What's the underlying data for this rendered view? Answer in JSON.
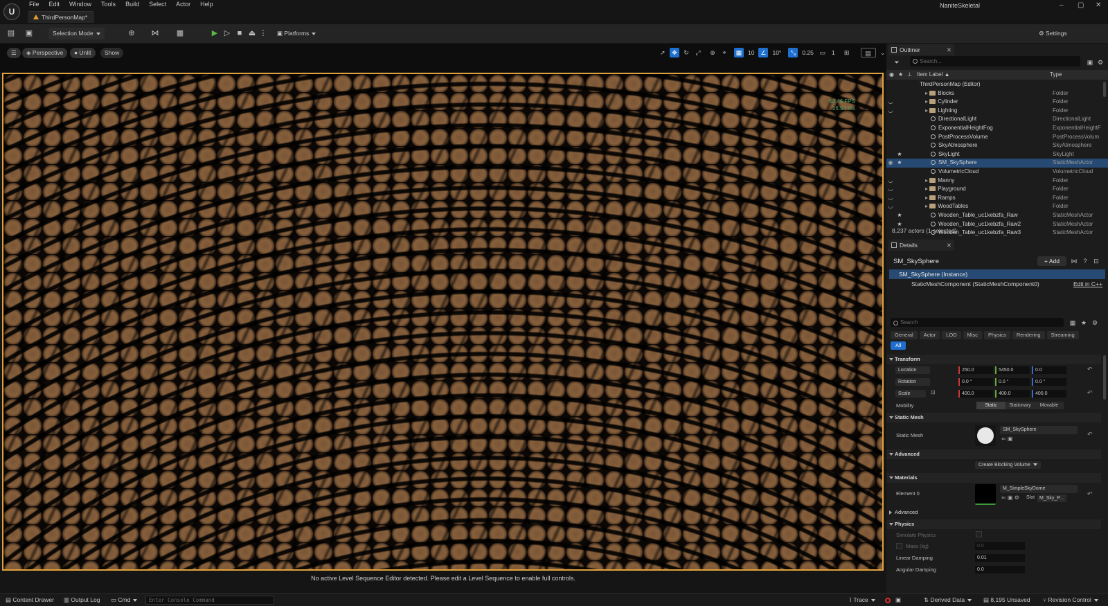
{
  "app": {
    "logo": "U",
    "project_name": "NaniteSkeletal",
    "document_tab": "ThirdPersonMap*",
    "menu": [
      "File",
      "Edit",
      "Window",
      "Tools",
      "Build",
      "Select",
      "Actor",
      "Help"
    ],
    "window_controls": [
      "–",
      "▢",
      "✕"
    ]
  },
  "toolbar": {
    "selection_mode": "Selection Mode",
    "platforms": "Platforms",
    "settings": "Settings"
  },
  "viewport": {
    "view_mode": "Perspective",
    "lighting_mode": "Unlit",
    "show": "Show",
    "grid_snap": "10",
    "rotation_snap": "10°",
    "scale_snap": "0.25",
    "camera_speed": "1",
    "fps": "60.46 FPS",
    "frame_ms": "16.54 ms",
    "sequence_message": "No active Level Sequence Editor detected. Please edit a Level Sequence to enable full controls."
  },
  "statusbar": {
    "content_drawer": "Content Drawer",
    "output_log": "Output Log",
    "cmd": "Cmd",
    "console_placeholder": "Enter Console Command",
    "trace": "Trace",
    "derived_data": "Derived Data",
    "unsaved": "8,195 Unsaved",
    "revision_control": "Revision Control"
  },
  "outliner": {
    "tab_label": "Outliner",
    "search_placeholder": "Search...",
    "columns": {
      "label": "Item Label ▲",
      "type": "Type"
    },
    "rows": [
      {
        "label": "ThirdPersonMap (Editor)",
        "type": "",
        "indent": 1,
        "kind": "map",
        "vis": "",
        "star": ""
      },
      {
        "label": "Blocks",
        "type": "Folder",
        "indent": 2,
        "kind": "folder",
        "vis": "",
        "star": ""
      },
      {
        "label": "Cylinder",
        "type": "Folder",
        "indent": 2,
        "kind": "folder",
        "vis": "◡",
        "star": ""
      },
      {
        "label": "Lighting",
        "type": "Folder",
        "indent": 2,
        "kind": "folder",
        "vis": "◡",
        "star": ""
      },
      {
        "label": "DirectionalLight",
        "type": "DirectionalLight",
        "indent": 3,
        "kind": "actor",
        "vis": "",
        "star": ""
      },
      {
        "label": "ExponentialHeightFog",
        "type": "ExponentialHeightF",
        "indent": 3,
        "kind": "actor",
        "vis": "",
        "star": ""
      },
      {
        "label": "PostProcessVolume",
        "type": "PostProcessVolum",
        "indent": 3,
        "kind": "actor",
        "vis": "",
        "star": ""
      },
      {
        "label": "SkyAtmosphere",
        "type": "SkyAtmosphere",
        "indent": 3,
        "kind": "actor",
        "vis": "",
        "star": ""
      },
      {
        "label": "SkyLight",
        "type": "SkyLight",
        "indent": 3,
        "kind": "actor",
        "vis": "",
        "star": "★"
      },
      {
        "label": "SM_SkySphere",
        "type": "StaticMeshActor",
        "indent": 3,
        "kind": "actor",
        "vis": "◉",
        "star": "★"
      },
      {
        "label": "VolumetricCloud",
        "type": "VolumetricCloud",
        "indent": 3,
        "kind": "actor",
        "vis": "",
        "star": ""
      },
      {
        "label": "Manny",
        "type": "Folder",
        "indent": 2,
        "kind": "folder",
        "vis": "◡",
        "star": ""
      },
      {
        "label": "Playground",
        "type": "Folder",
        "indent": 2,
        "kind": "folder",
        "vis": "◡",
        "star": ""
      },
      {
        "label": "Ramps",
        "type": "Folder",
        "indent": 2,
        "kind": "folder",
        "vis": "◡",
        "star": ""
      },
      {
        "label": "WoodTables",
        "type": "Folder",
        "indent": 2,
        "kind": "folder",
        "vis": "◡",
        "star": ""
      },
      {
        "label": "Wooden_Table_uc1kebzfa_Raw",
        "type": "StaticMeshActor",
        "indent": 3,
        "kind": "actor",
        "vis": "",
        "star": "★"
      },
      {
        "label": "Wooden_Table_uc1kebzfa_Raw2",
        "type": "StaticMeshActor",
        "indent": 3,
        "kind": "actor",
        "vis": "",
        "star": "★"
      },
      {
        "label": "Wooden_Table_uc1kebzfa_Raw3",
        "type": "StaticMeshActor",
        "indent": 3,
        "kind": "actor",
        "vis": "",
        "star": ""
      }
    ],
    "selected_label": "SM_SkySphere",
    "actor_count": "8,237 actors (1 selected)"
  },
  "details": {
    "tab_label": "Details",
    "actor_name": "SM_SkySphere",
    "add_label": "+ Add",
    "instance_label": "SM_SkySphere (Instance)",
    "component_label": "StaticMeshComponent (StaticMeshComponent0)",
    "edit_cpp": "Edit in C++",
    "search_placeholder": "Search",
    "category_tabs": [
      "General",
      "Actor",
      "LOD",
      "Misc",
      "Physics",
      "Rendering",
      "Streaming"
    ],
    "all_tab": "All",
    "sections": {
      "transform": "Transform",
      "static_mesh": "Static Mesh",
      "advanced": "Advanced",
      "materials": "Materials",
      "advanced2": "Advanced",
      "physics": "Physics"
    },
    "transform": {
      "location_label": "Location",
      "location": [
        "250.0",
        "5450.0",
        "0.0"
      ],
      "rotation_label": "Rotation",
      "rotation": [
        "0.0 °",
        "0.0 °",
        "0.0 °"
      ],
      "scale_label": "Scale",
      "scale": [
        "400.0",
        "400.0",
        "400.0"
      ],
      "mobility_label": "Mobility",
      "mobility_options": [
        "Static",
        "Stationary",
        "Movable"
      ],
      "mobility_selected": "Static"
    },
    "static_mesh": {
      "label": "Static Mesh",
      "asset": "SM_SkySphere"
    },
    "advanced": {
      "create_blocking_volume": "Create Blocking Volume"
    },
    "materials": {
      "element_label": "Element 0",
      "asset": "M_SimpleSkyDome",
      "slot_label": "Slot",
      "slot_value": "M_Sky_P..."
    },
    "physics": {
      "simulate_label": "Simulate Physics",
      "mass_label": "Mass (kg)",
      "mass_value": "0.0",
      "linear_damping_label": "Linear Damping",
      "linear_damping": "0.01",
      "angular_damping_label": "Angular Damping",
      "angular_damping": "0.0"
    }
  },
  "colors": {
    "accent": "#1f6fcf",
    "viewport_border": "#e2a23b",
    "selection": "#264a73",
    "x_axis": "#c83a3a",
    "y_axis": "#6aa83a",
    "z_axis": "#3a6ad0"
  }
}
